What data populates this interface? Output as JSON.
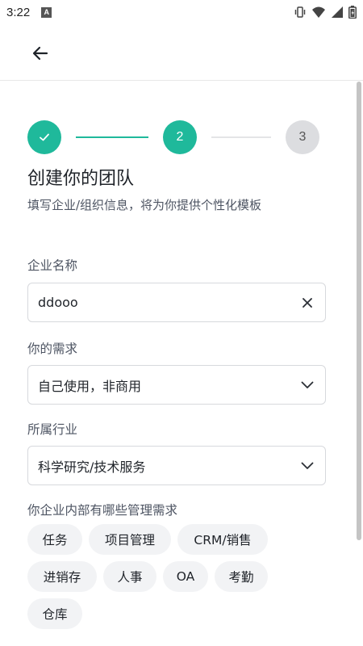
{
  "status_bar": {
    "time": "3:22",
    "notification_badge": "A",
    "icons": [
      "vibrate-icon",
      "wifi-icon",
      "signal-icon",
      "battery-icon"
    ]
  },
  "app_bar": {
    "back_icon": "arrow-left-icon"
  },
  "stepper": {
    "steps": [
      {
        "label": "",
        "state": "completed",
        "icon": "check-icon"
      },
      {
        "label": "2",
        "state": "active"
      },
      {
        "label": "3",
        "state": "pending"
      }
    ]
  },
  "page": {
    "title": "创建你的团队",
    "subtitle": "填写企业/组织信息，将为你提供个性化模板"
  },
  "form": {
    "company_name": {
      "label": "企业名称",
      "value": "ddooo",
      "clear_icon": "close-icon"
    },
    "need": {
      "label": "你的需求",
      "value": "自己使用，非商用",
      "icon": "chevron-down-icon"
    },
    "industry": {
      "label": "所属行业",
      "value": "科学研究/技术服务",
      "icon": "chevron-down-icon"
    },
    "management": {
      "label": "你企业内部有哪些管理需求",
      "chips": [
        "任务",
        "项目管理",
        "CRM/销售",
        "进销存",
        "人事",
        "OA",
        "考勤",
        "仓库"
      ]
    }
  },
  "colors": {
    "accent": "#1fb99b",
    "pending_step": "#dcdde0",
    "chip_bg": "#f2f3f5",
    "border": "#d7d9dd"
  }
}
